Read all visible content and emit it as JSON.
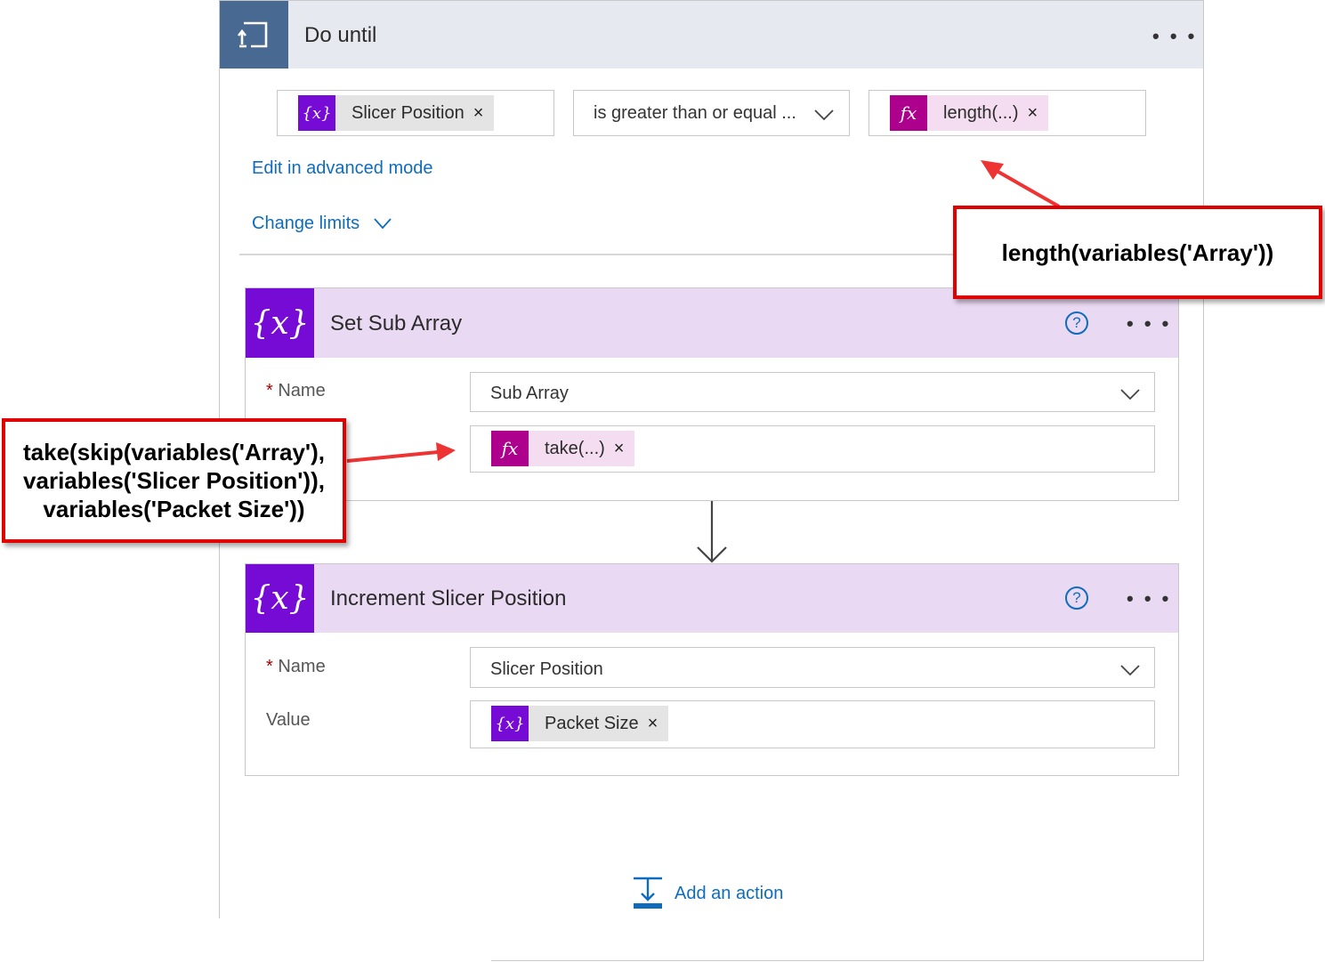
{
  "do_until": {
    "title": "Do until",
    "more_label": "• • •",
    "condition": {
      "left_token": {
        "label": "Slicer Position",
        "icon": "variable-icon",
        "icon_glyph": "{x}"
      },
      "operator": "is greater than or equal ...",
      "right_token": {
        "label": "length(...)",
        "icon": "expression-icon",
        "icon_glyph": "fx"
      }
    },
    "advanced_mode_label": "Edit in advanced mode",
    "change_limits_label": "Change limits"
  },
  "actions": [
    {
      "title": "Set Sub Array",
      "icon_glyph": "{x}",
      "help_label": "?",
      "more_label": "• • •",
      "name_label": "Name",
      "name_value": "Sub Array",
      "value_token": {
        "label": "take(...)",
        "icon": "expression-icon",
        "icon_glyph": "fx"
      }
    },
    {
      "title": "Increment Slicer Position",
      "icon_glyph": "{x}",
      "help_label": "?",
      "more_label": "• • •",
      "name_label": "Name",
      "name_value": "Slicer Position",
      "value_label": "Value",
      "value_token": {
        "label": "Packet Size",
        "icon": "variable-icon",
        "icon_glyph": "{x}"
      }
    }
  ],
  "add_action_label": "Add an action",
  "required_marker": "*",
  "token_close_glyph": "×",
  "callouts": {
    "length": "length(variables('Array'))",
    "take_lines": [
      "take(skip(variables('Array'),",
      "variables('Slicer Position')),",
      "variables('Packet Size'))"
    ]
  },
  "colors": {
    "do_until_accent": "#486991",
    "variable_purple": "#770bd6",
    "expression_magenta": "#ad008c",
    "action_header_bg": "#ead9f3",
    "link_blue": "#0f6cbd",
    "callout_red": "#e00000"
  }
}
